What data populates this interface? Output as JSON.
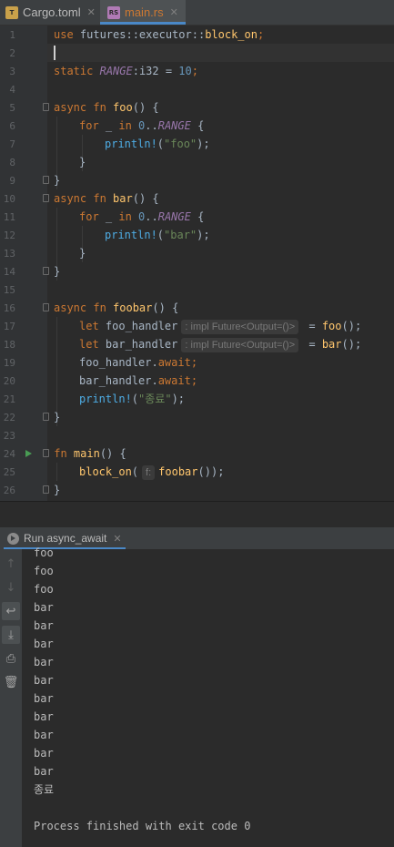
{
  "tabs": [
    {
      "label": "Cargo.toml",
      "icon": "toml-file-icon",
      "active": false
    },
    {
      "label": "main.rs",
      "icon": "rust-file-icon",
      "active": true
    }
  ],
  "editor": {
    "line_numbers": [
      "1",
      "2",
      "3",
      "4",
      "5",
      "6",
      "7",
      "8",
      "9",
      "10",
      "11",
      "12",
      "13",
      "14",
      "15",
      "16",
      "17",
      "18",
      "19",
      "20",
      "21",
      "22",
      "23",
      "24",
      "25",
      "26"
    ],
    "code": {
      "l1_use": "use",
      "l1_path": " futures::executor::",
      "l1_fn": "block_on",
      "l1_semi": ";",
      "l3_static": "static",
      "l3_name": "RANGE",
      "l3_type": ":i32 = ",
      "l3_value": "10",
      "l3_semi": ";",
      "async": "async",
      "fn": " fn ",
      "foo": "foo",
      "bar": "bar",
      "foobar": "foobar",
      "main": "main",
      "parens_brace": "() {",
      "for": "for",
      "for_mid": " _ ",
      "in": "in",
      "zero": " 0",
      "dots": "..",
      "range": "RANGE",
      "brace_open": " {",
      "println": "println!",
      "str_foo": "\"foo\"",
      "str_bar": "\"bar\"",
      "str_end": "\"종료\"",
      "paren_open": "(",
      "paren_close_semi": ");",
      "brace_close": "}",
      "let": "let",
      "foo_handler": " foo_handler",
      "bar_handler": " bar_handler",
      "type_hint": ": impl Future<Output=()>",
      "assign": " = ",
      "call_semi": "();",
      "foo_handler_await": "foo_handler.",
      "bar_handler_await": "bar_handler.",
      "await": "await",
      "semi": ";",
      "block_on": "block_on",
      "param_hint": "f:",
      "foobar_call": "foobar",
      "close_call": "());"
    }
  },
  "run_panel": {
    "tab_label": "Run",
    "config_name": "async_await",
    "output_lines": [
      "foo",
      "foo",
      "foo",
      "bar",
      "bar",
      "bar",
      "bar",
      "bar",
      "bar",
      "bar",
      "bar",
      "bar",
      "bar",
      "종료",
      "",
      "Process finished with exit code 0"
    ]
  },
  "icons": {
    "up": "arrow-up-icon",
    "down": "arrow-down-icon",
    "wrap": "soft-wrap-icon",
    "scroll_end": "scroll-to-end-icon",
    "print": "print-icon",
    "trash": "trash-icon",
    "run": "run-gutter-icon"
  },
  "colors": {
    "keyword": "#cc7832",
    "function": "#ffc66d",
    "string": "#6a8759",
    "number": "#6897bb",
    "macro": "#4eade5",
    "constant": "#9876aa",
    "background": "#2b2b2b"
  }
}
